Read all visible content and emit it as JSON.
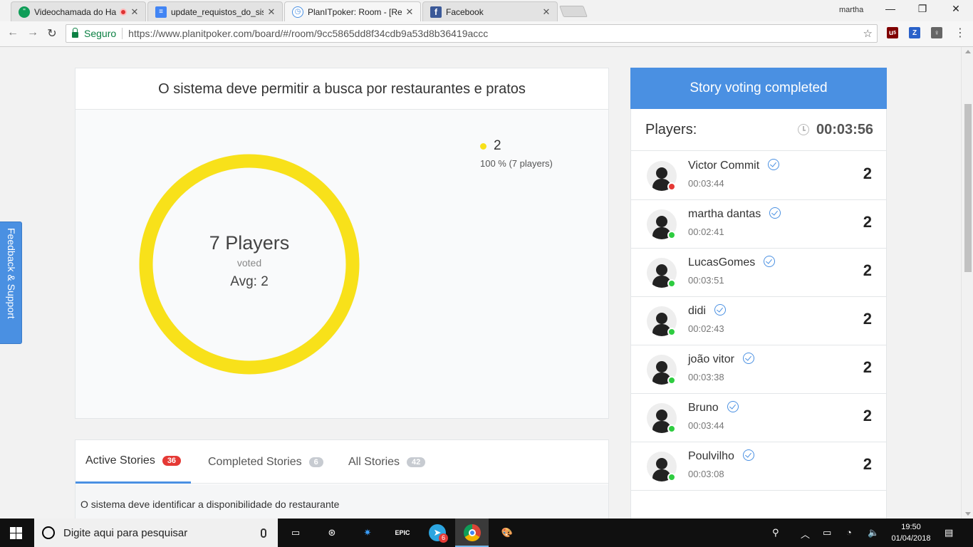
{
  "browser": {
    "tabs": [
      {
        "title": "Videochamada do Ha",
        "icon": "hangouts-icon",
        "color": "#0f9d58"
      },
      {
        "title": "update_requistos_do_sist",
        "icon": "google-docs-icon",
        "color": "#4285f4"
      },
      {
        "title": "PlanITpoker: Room - [Rec",
        "icon": "planitpoker-icon",
        "color": "#4a90e2"
      },
      {
        "title": "Facebook",
        "icon": "facebook-icon",
        "color": "#3b5998"
      }
    ],
    "user": "martha",
    "secure_label": "Seguro",
    "url": "https://www.planitpoker.com/board/#/room/9cc5865dd8f34cdb9a53d8b36419accc",
    "extension_badge": "5"
  },
  "story": {
    "title": "O sistema deve permitir a busca por restaurantes e pratos",
    "players_count": "7 Players",
    "voted_label": "voted",
    "average": "Avg: 2",
    "legend_value": "2",
    "legend_percent": "100 % (7 players)",
    "legend_color": "#f8e11a",
    "vote_share": 1.0
  },
  "stories_tabs": [
    {
      "label": "Active Stories",
      "count": "36",
      "badge_color": "#e53935"
    },
    {
      "label": "Completed Stories",
      "count": "6",
      "badge_color": "#c7cbd1"
    },
    {
      "label": "All Stories",
      "count": "42",
      "badge_color": "#c7cbd1"
    }
  ],
  "story_row": "O sistema deve identificar a disponibilidade do restaurante",
  "feedback_label": "Feedback & Support",
  "panel": {
    "banner": "Story voting completed",
    "players_label": "Players:",
    "timer": "00:03:56",
    "players": [
      {
        "name": "Victor Commit",
        "time": "00:03:44",
        "vote": "2",
        "status_color": "#e53935"
      },
      {
        "name": "martha dantas",
        "time": "00:02:41",
        "vote": "2",
        "status_color": "#2ecc40"
      },
      {
        "name": "LucasGomes",
        "time": "00:03:51",
        "vote": "2",
        "status_color": "#2ecc40"
      },
      {
        "name": "didi",
        "time": "00:02:43",
        "vote": "2",
        "status_color": "#2ecc40"
      },
      {
        "name": "joão vitor",
        "time": "00:03:38",
        "vote": "2",
        "status_color": "#2ecc40"
      },
      {
        "name": "Bruno",
        "time": "00:03:44",
        "vote": "2",
        "status_color": "#2ecc40"
      },
      {
        "name": "Poulvilho",
        "time": "00:03:08",
        "vote": "2",
        "status_color": "#2ecc40"
      }
    ]
  },
  "taskbar": {
    "search_placeholder": "Digite aqui para pesquisar",
    "telegram_badge": "6",
    "epic_label": "EPIC",
    "time": "19:50",
    "date": "01/04/2018"
  }
}
